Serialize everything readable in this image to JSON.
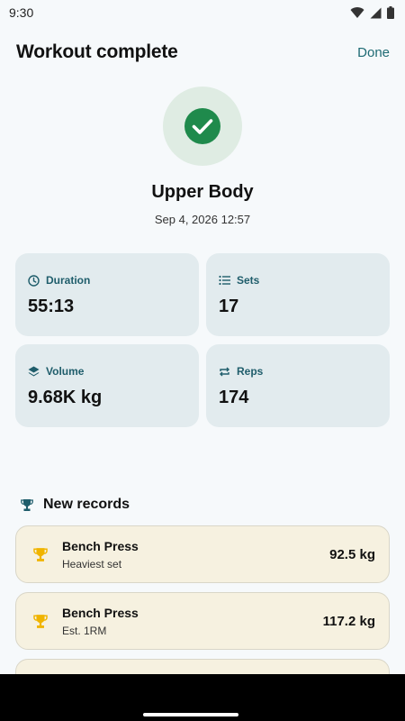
{
  "status": {
    "time": "9:30"
  },
  "header": {
    "title": "Workout complete",
    "done_label": "Done"
  },
  "summary": {
    "workout_name": "Upper Body",
    "date": "Sep 4, 2026 12:57"
  },
  "stats": [
    {
      "label": "Duration",
      "value": "55:13",
      "icon": "clock-icon"
    },
    {
      "label": "Sets",
      "value": "17",
      "icon": "list-icon"
    },
    {
      "label": "Volume",
      "value": "9.68K kg",
      "icon": "layers-icon"
    },
    {
      "label": "Reps",
      "value": "174",
      "icon": "repeat-icon"
    }
  ],
  "records": {
    "title": "New records",
    "items": [
      {
        "exercise": "Bench Press",
        "type": "Heaviest set",
        "value": "92.5 kg"
      },
      {
        "exercise": "Bench Press",
        "type": "Est. 1RM",
        "value": "117.2 kg"
      }
    ]
  },
  "colors": {
    "accent": "#1f6b74",
    "success": "#1f8a4c",
    "stat_card_bg": "#e2ebee",
    "record_card_bg": "#f6f1e0",
    "trophy": "#f0b400"
  }
}
